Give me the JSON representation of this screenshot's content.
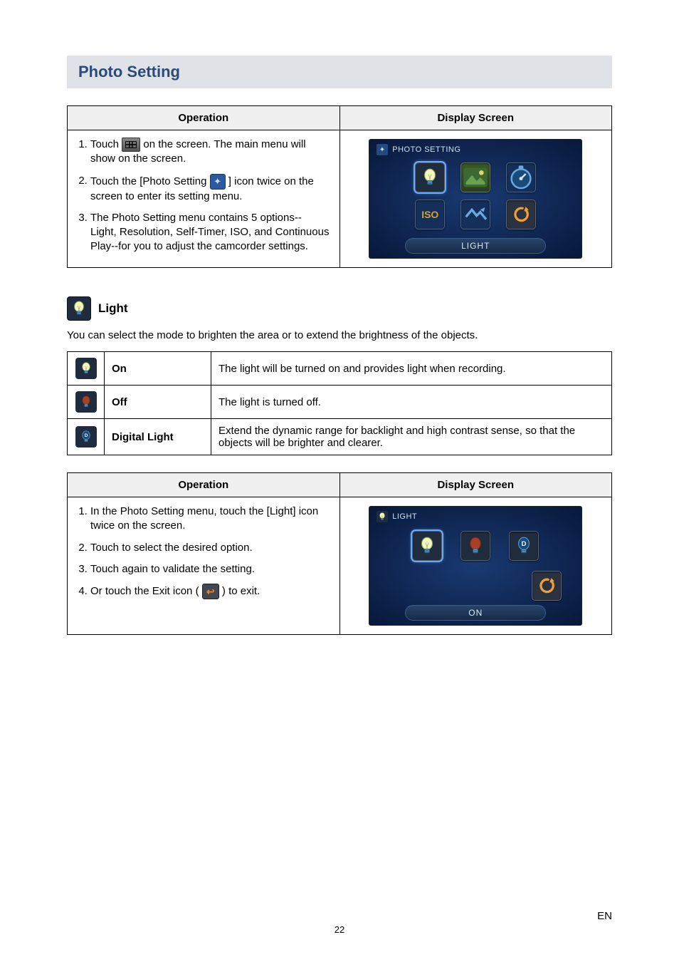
{
  "section_title": "Photo Setting",
  "op_header": "Operation",
  "ds_header": "Display Screen",
  "steps1": {
    "s1a": "Touch ",
    "s1b": " on the screen. The main menu will show on the screen.",
    "s2a": "Touch the [Photo Setting ",
    "s2b": " ] icon twice on the screen to enter its setting menu.",
    "s3": "The Photo Setting menu contains 5 options-- Light, Resolution, Self-Timer, ISO, and Continuous Play--for you to adjust the camcorder settings."
  },
  "screen1": {
    "title": "PHOTO SETTING",
    "caption": "LIGHT",
    "iso": "ISO"
  },
  "light_section": {
    "title": "Light",
    "intro": "You can select the mode to brighten the area or to extend the brightness of the objects.",
    "rows": [
      {
        "name": "On",
        "desc": "The light will be turned on and provides light when recording."
      },
      {
        "name": "Off",
        "desc": "The light is turned off."
      },
      {
        "name": "Digital Light",
        "desc": "Extend the dynamic range for backlight and high contrast sense, so that the objects will be brighter and clearer."
      }
    ]
  },
  "steps2": {
    "s1": "In the Photo Setting menu, touch the [Light] icon twice on the screen.",
    "s2": "Touch to select the desired option.",
    "s3": "Touch again to validate the setting.",
    "s4a": "Or touch the Exit icon ( ",
    "s4b": " ) to exit."
  },
  "screen2": {
    "title": "LIGHT",
    "caption": "ON"
  },
  "page_num": "22",
  "lang": "EN"
}
